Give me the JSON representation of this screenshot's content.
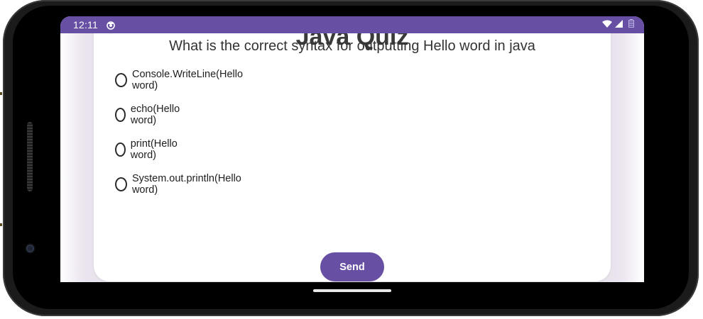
{
  "status_bar": {
    "time": "12:11",
    "app_icon": "notification-badge-icon",
    "wifi_icon": "wifi-icon",
    "signal_icon": "cell-signal-icon",
    "battery_icon": "battery-icon"
  },
  "quiz": {
    "title": "Java Quiz",
    "question": "What is the correct syntax for outputting Hello word in java",
    "options": [
      {
        "label": "Console.WriteLine(Hello word)",
        "selected": false
      },
      {
        "label": "echo(Hello word)",
        "selected": false
      },
      {
        "label": "print(Hello word)",
        "selected": false
      },
      {
        "label": "System.out.println(Hello word)",
        "selected": false
      }
    ],
    "send_label": "Send"
  },
  "colors": {
    "accent": "#6750a4",
    "background": "#f3edf5",
    "card": "#ffffff"
  }
}
